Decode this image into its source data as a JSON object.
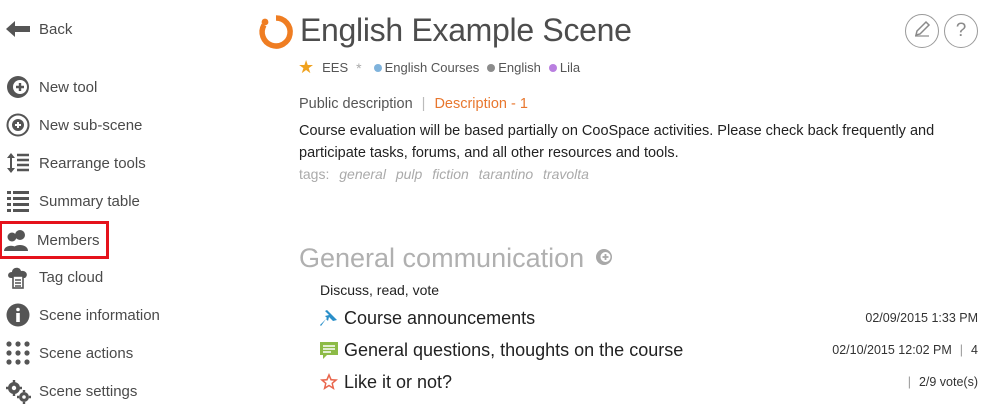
{
  "sidebar": {
    "back_label": "Back",
    "items": [
      {
        "label": "New tool",
        "icon": "new-tool-icon"
      },
      {
        "label": "New sub-scene",
        "icon": "new-sub-scene-icon"
      },
      {
        "label": "Rearrange tools",
        "icon": "rearrange-icon"
      },
      {
        "label": "Summary table",
        "icon": "summary-table-icon"
      },
      {
        "label": "Members",
        "icon": "members-icon"
      },
      {
        "label": "Tag cloud",
        "icon": "tag-cloud-icon"
      },
      {
        "label": "Scene information",
        "icon": "info-icon"
      },
      {
        "label": "Scene actions",
        "icon": "dots-grid-icon"
      },
      {
        "label": "Scene settings",
        "icon": "gears-icon"
      }
    ]
  },
  "header": {
    "title": "English Example Scene",
    "meta": {
      "code": "EES",
      "asterisk": "*",
      "chips": [
        {
          "label": "English Courses",
          "color": "#7fb3dc"
        },
        {
          "label": "English",
          "color": "#8c8c8c"
        },
        {
          "label": "Lila",
          "color": "#b97fe0"
        }
      ]
    }
  },
  "description": {
    "tab_public": "Public description",
    "separator": "|",
    "tab_active": "Description - 1",
    "text": "Course evaluation will be based partially on CooSpace activities. Please check back frequently and participate tasks, forums, and all other resources and tools.",
    "tags_label": "tags:",
    "tags": [
      "general",
      "pulp",
      "fiction",
      "tarantino",
      "travolta"
    ]
  },
  "section": {
    "title": "General communication",
    "subtitle": "Discuss, read, vote",
    "tools": [
      {
        "name": "Course announcements",
        "icon": "pin-icon",
        "meta_left": "02/09/2015 1:33 PM",
        "meta_right": ""
      },
      {
        "name": "General questions, thoughts on the course",
        "icon": "forum-icon",
        "meta_left": "02/10/2015 12:02 PM",
        "meta_right": "4"
      },
      {
        "name": "Like it or not?",
        "icon": "vote-star-icon",
        "meta_left": "",
        "meta_right": "2/9 vote(s)"
      }
    ]
  },
  "colors": {
    "accent": "#e8772e",
    "highlight": "#e5121b"
  }
}
